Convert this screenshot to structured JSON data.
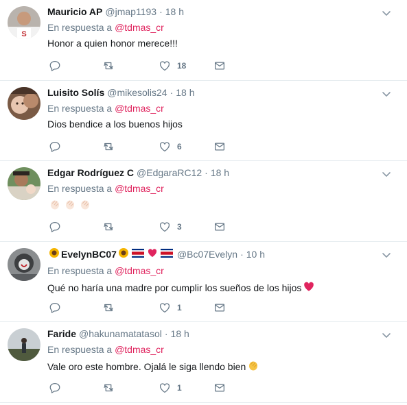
{
  "tweets": [
    {
      "name": "Mauricio AP",
      "handle": "@jmap1193",
      "time": "18 h",
      "reply_prefix": "En respuesta a",
      "reply_to": "@tdmas_cr",
      "text": "Honor a quien honor merece!!!",
      "likes": "18",
      "avatar_icon": "avatar-photo"
    },
    {
      "name": "Luisito Solís",
      "handle": "@mikesolis24",
      "time": "18 h",
      "reply_prefix": "En respuesta a",
      "reply_to": "@tdmas_cr",
      "text": "Dios bendice a los buenos hijos",
      "likes": "6",
      "avatar_icon": "avatar-photo"
    },
    {
      "name": "Edgar Rodríguez C",
      "handle": "@EdgaraRC12",
      "time": "18 h",
      "reply_prefix": "En respuesta a",
      "reply_to": "@tdmas_cr",
      "text": "",
      "text_emoji": [
        "clap-emoji",
        "clap-emoji",
        "clap-emoji"
      ],
      "likes": "3",
      "avatar_icon": "avatar-photo"
    },
    {
      "name": "EvelynBC07",
      "name_emoji_before": [
        "sunflower-emoji"
      ],
      "name_emoji_after": [
        "sunflower-emoji",
        "costa-rica-flag-emoji",
        "red-heart-emoji",
        "costa-rica-flag-emoji"
      ],
      "handle": "@Bc07Evelyn",
      "time": "10 h",
      "reply_prefix": "En respuesta a",
      "reply_to": "@tdmas_cr",
      "text": "Qué no haría una madre por cumplir los sueños de los hijos",
      "text_emoji": [
        "red-heart-emoji"
      ],
      "likes": "1",
      "avatar_icon": "avatar-photo"
    },
    {
      "name": "Faride",
      "handle": "@hakunamatatasol",
      "time": "18 h",
      "reply_prefix": "En respuesta a",
      "reply_to": "@tdmas_cr",
      "text": "Vale oro este hombre. Ojalá le siga llendo bien",
      "text_emoji": [
        "clap-emoji"
      ],
      "likes": "1",
      "avatar_icon": "avatar-photo"
    }
  ],
  "colors": {
    "mention": "#e0245e",
    "secondary_text": "#657786",
    "primary_text": "#14171a",
    "divider": "#e6ecf0",
    "heart": "#e0245e"
  },
  "icons": {
    "reply": "reply-icon",
    "retweet": "retweet-icon",
    "like": "heart-icon",
    "dm": "envelope-icon",
    "more": "chevron-down-icon"
  }
}
